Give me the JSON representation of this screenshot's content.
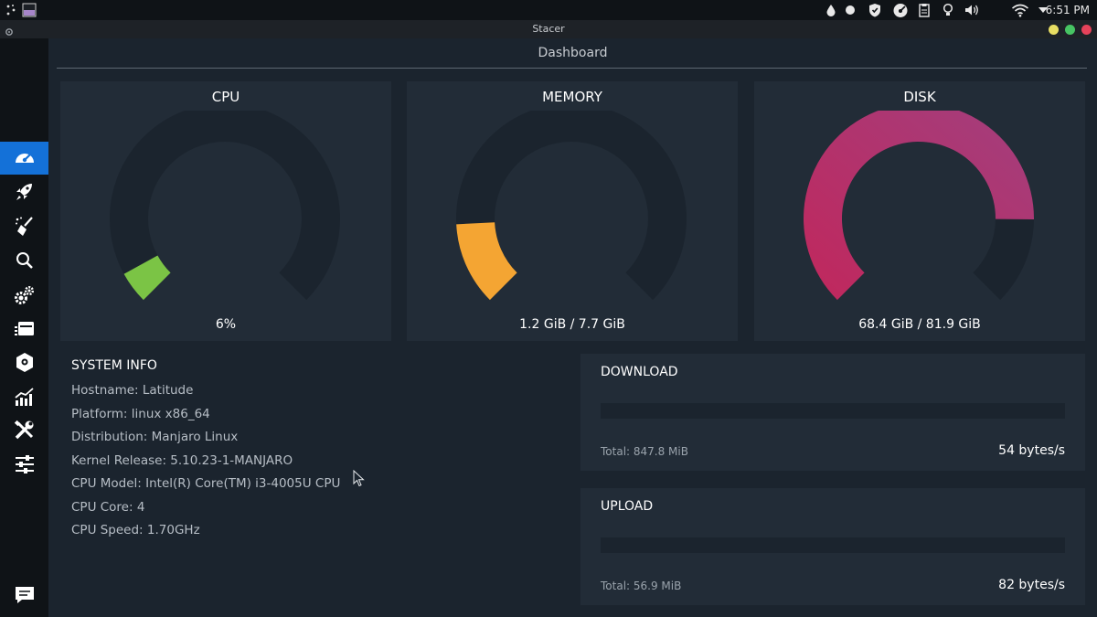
{
  "system_panel": {
    "clock": "6:51 PM",
    "icons": [
      "app-launcher-icon",
      "workspace-icon",
      "drop-icon",
      "record-icon",
      "shield-icon",
      "stacer-tray-icon",
      "clipboard-icon",
      "bulb-icon",
      "volume-icon",
      "wifi-icon",
      "dropdown-arrow-icon"
    ]
  },
  "window": {
    "title": "Stacer",
    "controls": {
      "minimize_color": "#e8de63",
      "maximize_color": "#47c463",
      "close_color": "#e6425a"
    }
  },
  "sidebar": {
    "items": [
      {
        "icon": "dashboard-gauge-icon",
        "active": true
      },
      {
        "icon": "rocket-icon",
        "active": false
      },
      {
        "icon": "broom-cleaner-icon",
        "active": false
      },
      {
        "icon": "search-icon",
        "active": false
      },
      {
        "icon": "services-gears-icon",
        "active": false
      },
      {
        "icon": "processes-icon",
        "active": false
      },
      {
        "icon": "uninstaller-icon",
        "active": false
      },
      {
        "icon": "resources-chart-icon",
        "active": false
      },
      {
        "icon": "tools-icon",
        "active": false
      },
      {
        "icon": "settings-sliders-icon",
        "active": false
      }
    ],
    "feedback_icon": "feedback-chat-icon",
    "active_color": "#1471d8"
  },
  "dashboard": {
    "title": "Dashboard",
    "gauges": [
      {
        "title": "CPU",
        "value_text": "6%",
        "fraction": 0.06,
        "color": "#7bc445"
      },
      {
        "title": "MEMORY",
        "value_text": "1.2 GiB / 7.7 GiB",
        "fraction": 0.156,
        "color": "#f4a533"
      },
      {
        "title": "DISK",
        "value_text": "68.4 GiB / 81.9 GiB",
        "fraction": 0.835,
        "color_start": "#c1275c",
        "color_end": "#a23f7e"
      }
    ],
    "gauge_track_color": "#1b242e",
    "system_info": {
      "title": "SYSTEM INFO",
      "rows": [
        "Hostname: Latitude",
        "Platform: linux x86_64",
        "Distribution: Manjaro Linux",
        "Kernel Release: 5.10.23-1-MANJARO",
        "CPU Model: Intel(R) Core(TM) i3-4005U CPU",
        "CPU Core: 4",
        "CPU Speed: 1.70GHz"
      ]
    },
    "network": {
      "download": {
        "title": "DOWNLOAD",
        "total": "Total: 847.8 MiB",
        "speed": "54 bytes/s"
      },
      "upload": {
        "title": "UPLOAD",
        "total": "Total: 56.9 MiB",
        "speed": "82 bytes/s"
      }
    }
  }
}
